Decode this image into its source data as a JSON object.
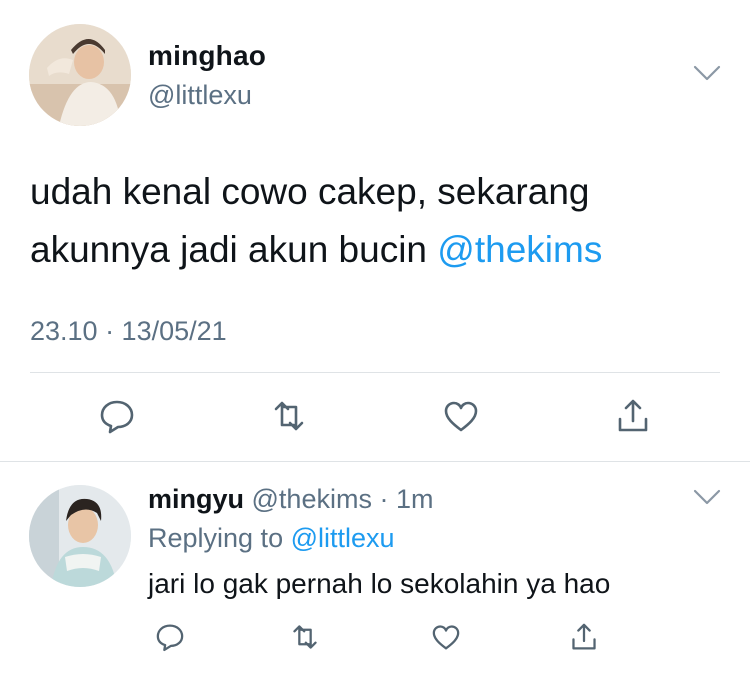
{
  "tweet": {
    "display_name": "minghao",
    "handle": "@littlexu",
    "text_line1": "udah kenal cowo cakep, sekarang",
    "text_line2": "akunnya jadi akun bucin ",
    "mention": "@thekims",
    "timestamp": "23.10 · 13/05/21",
    "actions": [
      "reply-icon",
      "retweet-icon",
      "like-icon",
      "share-icon"
    ]
  },
  "reply": {
    "display_name": "mingyu",
    "handle": " @thekims",
    "separator": " · ",
    "time": "1m",
    "replying_prefix": "Replying to ",
    "replying_handle": "@littlexu",
    "text": "jari lo gak pernah lo sekolahin ya hao",
    "actions": [
      "reply-icon",
      "retweet-icon",
      "like-icon",
      "share-icon"
    ]
  },
  "colors": {
    "text": "#0f1419",
    "secondary": "#5b7083",
    "link": "#1d9bf0",
    "divider": "#dfe3e6"
  }
}
